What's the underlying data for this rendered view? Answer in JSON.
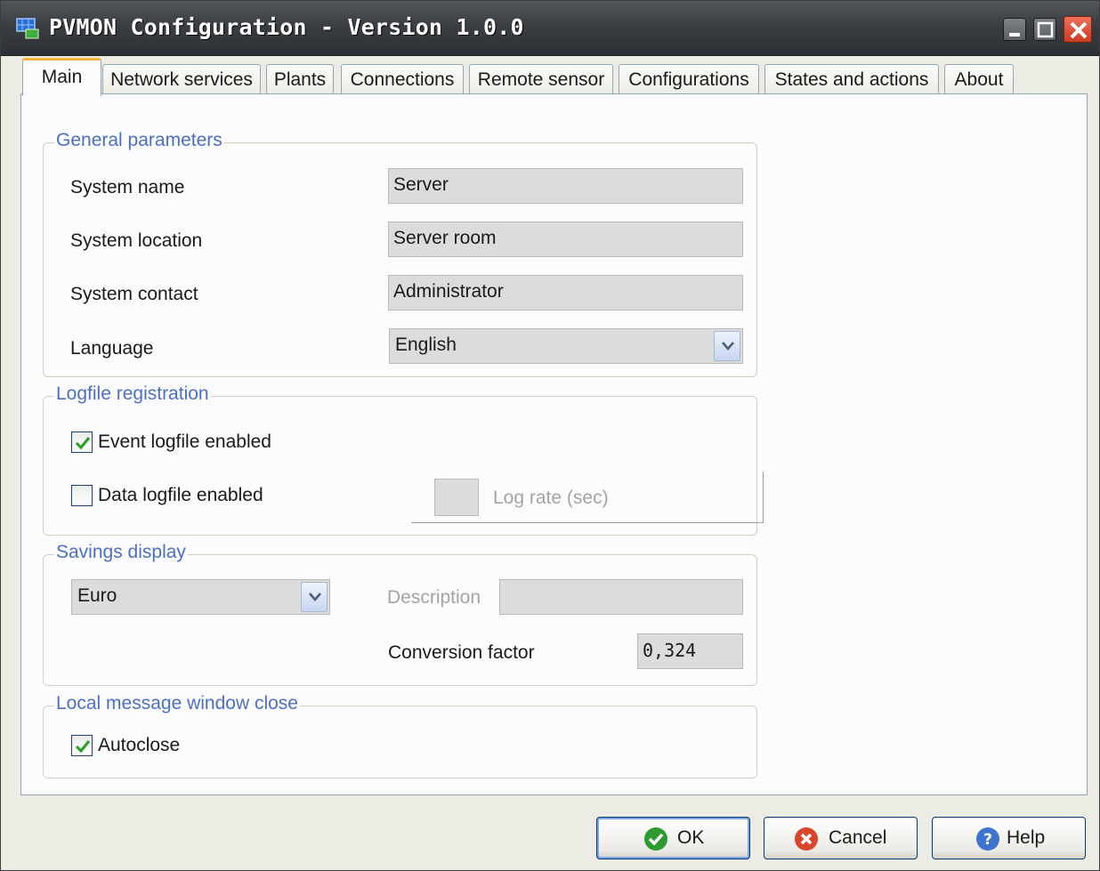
{
  "window": {
    "title": "PVMON Configuration - Version 1.0.0"
  },
  "tabs": [
    {
      "label": "Main",
      "active": true
    },
    {
      "label": "Network services"
    },
    {
      "label": "Plants"
    },
    {
      "label": "Connections"
    },
    {
      "label": "Remote sensor"
    },
    {
      "label": "Configurations"
    },
    {
      "label": "States and actions"
    },
    {
      "label": "About"
    }
  ],
  "general": {
    "title": "General parameters",
    "system_name_label": "System name",
    "system_name_value": "Server",
    "system_location_label": "System location",
    "system_location_value": "Server room",
    "system_contact_label": "System contact",
    "system_contact_value": "Administrator",
    "language_label": "Language",
    "language_value": "English"
  },
  "logfile": {
    "title": "Logfile registration",
    "event_label": "Event logfile enabled",
    "event_checked": true,
    "data_label": "Data logfile enabled",
    "data_checked": false,
    "log_rate_label": "Log rate (sec)",
    "log_rate_value": ""
  },
  "savings": {
    "title": "Savings display",
    "currency_value": "Euro",
    "description_label": "Description",
    "description_value": "",
    "conversion_label": "Conversion factor",
    "conversion_value": "0,324"
  },
  "local_message": {
    "title": "Local message window close",
    "autoclose_label": "Autoclose",
    "autoclose_checked": true
  },
  "buttons": {
    "ok": "OK",
    "cancel": "Cancel",
    "help": "Help"
  },
  "colors": {
    "group_title": "#4b6fc7",
    "active_tab_accent": "#f6b33d",
    "ok_icon": "#2f9a2f",
    "cancel_icon": "#d8452a",
    "help_icon": "#3e74d0"
  },
  "icons": {
    "app": "solar-panel-icon",
    "minimize": "minimize-icon",
    "maximize": "maximize-icon",
    "close": "close-icon",
    "dropdown": "chevron-down-icon",
    "check": "checkmark-icon",
    "ok": "ok-check-icon",
    "cancel": "cancel-x-icon",
    "help": "help-question-icon"
  }
}
